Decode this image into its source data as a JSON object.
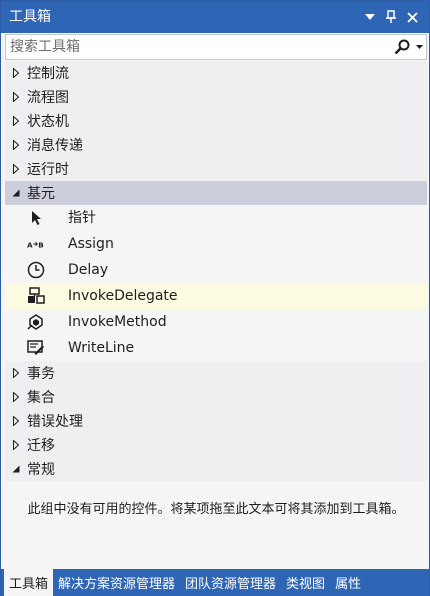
{
  "window": {
    "title": "工具箱",
    "colors": {
      "titlebar": "#2f65b5",
      "selected_row": "#cccedb",
      "hover_row": "#fdfbe2"
    }
  },
  "search": {
    "placeholder": "搜索工具箱"
  },
  "categories_top": [
    {
      "label": "控制流"
    },
    {
      "label": "流程图"
    },
    {
      "label": "状态机"
    },
    {
      "label": "消息传递"
    },
    {
      "label": "运行时"
    }
  ],
  "primitives": {
    "label": "基元",
    "items": [
      {
        "label": "指针",
        "icon": "pointer-icon"
      },
      {
        "label": "Assign",
        "icon": "assign-icon"
      },
      {
        "label": "Delay",
        "icon": "clock-icon"
      },
      {
        "label": "InvokeDelegate",
        "icon": "invoke-delegate-icon"
      },
      {
        "label": "InvokeMethod",
        "icon": "invoke-method-icon"
      },
      {
        "label": "WriteLine",
        "icon": "writeline-icon"
      }
    ]
  },
  "categories_bottom": [
    {
      "label": "事务"
    },
    {
      "label": "集合"
    },
    {
      "label": "错误处理"
    },
    {
      "label": "迁移"
    }
  ],
  "general": {
    "label": "常规",
    "empty_text": "此组中没有可用的控件。将某项拖至此文本可将其添加到工具箱。"
  },
  "tabs": [
    {
      "label": "工具箱"
    },
    {
      "label": "解决方案资源管理器"
    },
    {
      "label": "团队资源管理器"
    },
    {
      "label": "类视图"
    },
    {
      "label": "属性"
    }
  ]
}
